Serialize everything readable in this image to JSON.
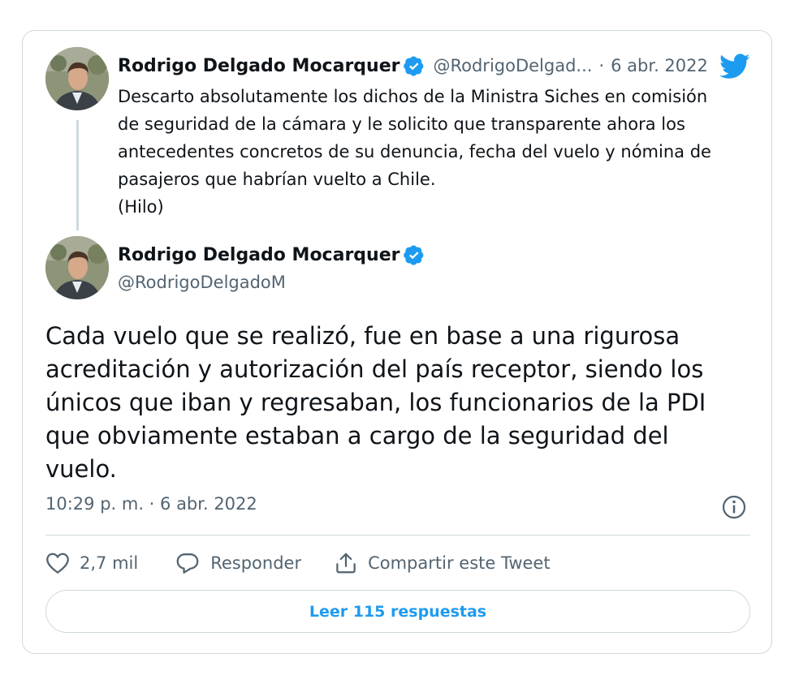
{
  "quoted_tweet": {
    "author_name": "Rodrigo Delgado Mocarquer",
    "handle": "@RodrigoDelgad...",
    "separator": "·",
    "date": "6 abr. 2022",
    "text_lines": [
      "Descarto absolutamente los dichos de la Ministra Siches en comisión",
      "de seguridad de la cámara y le solicito que transparente ahora los",
      "antecedentes concretos de su denuncia, fecha del vuelo y nómina de",
      "pasajeros que habrían vuelto a Chile.",
      "(Hilo)"
    ]
  },
  "main_tweet": {
    "author_name": "Rodrigo Delgado Mocarquer",
    "handle": "@RodrigoDelgadoM",
    "text_lines": [
      "Cada vuelo que se realizó, fue en base a una rigurosa",
      "acreditación y autorización del país receptor, siendo los",
      "únicos que iban y regresaban, los funcionarios de la PDI",
      "que obviamente estaban a cargo de la seguridad del",
      "vuelo."
    ],
    "timestamp": "10:29 p. m. · 6 abr. 2022"
  },
  "actions": {
    "like_count": "2,7 mil",
    "reply_label": "Responder",
    "share_label": "Compartir este Tweet"
  },
  "read_replies_label": "Leer 115 respuestas",
  "colors": {
    "twitter_blue": "#1d9bf0",
    "muted_text": "#536471",
    "border": "#cfd9de"
  }
}
